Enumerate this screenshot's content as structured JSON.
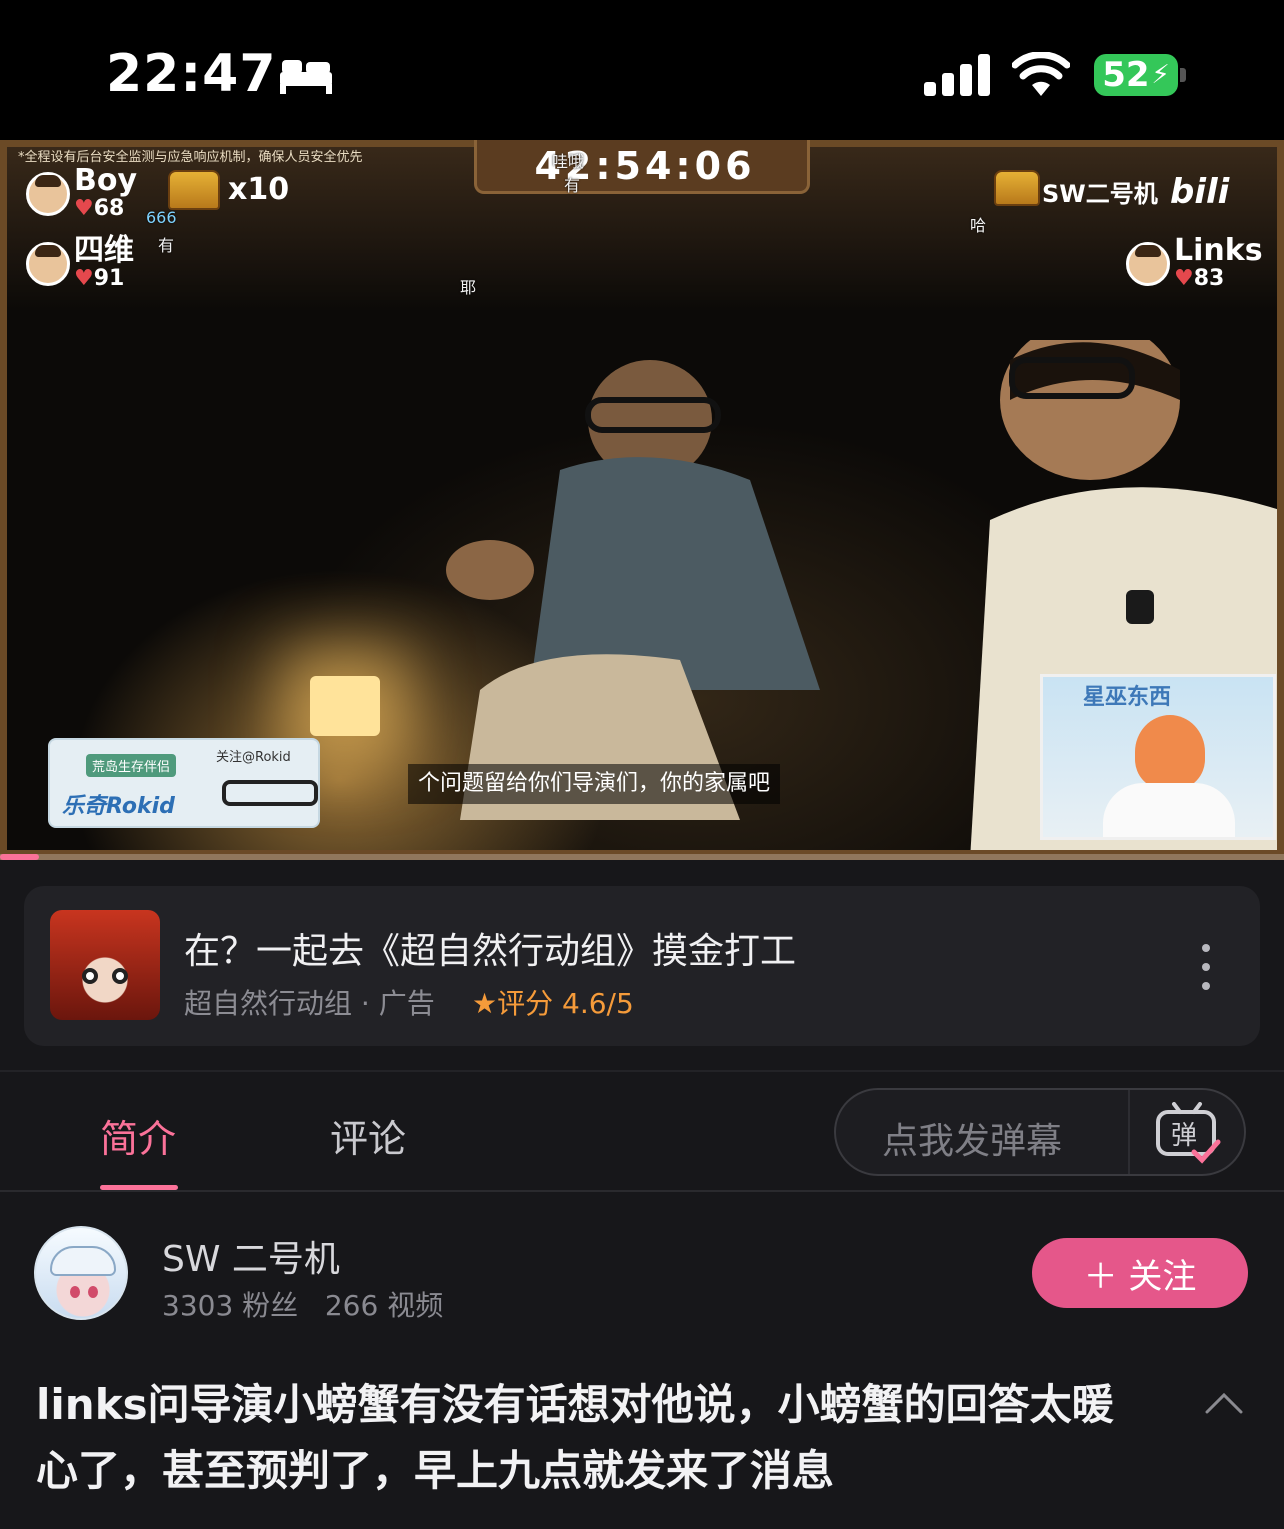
{
  "status_bar": {
    "time": "22:47",
    "battery": "52"
  },
  "video": {
    "safety_notice": "*全程设有后台安全监测与应急响应机制，确保人员安全优先",
    "timer": "42:54:06",
    "players": [
      {
        "name": "Boy",
        "hearts": "68"
      },
      {
        "name": "四维",
        "hearts": "91"
      },
      {
        "name": "Links",
        "hearts": "83"
      }
    ],
    "chest_count": "x10",
    "top_right_tag": "SW二号机",
    "platform_logo": "bilibili",
    "floating_danmaku": [
      "666",
      "有",
      "耶",
      "哇哦",
      "有",
      "哈"
    ],
    "subtitle": "个问题留给你们导演们，你的家属吧",
    "sponsor": {
      "tag": "荒岛生存伴侣",
      "follow": "关注@Rokid",
      "brand": "乐奇Rokid"
    },
    "pip_title": "星巫东西",
    "progress": 0.03
  },
  "ad": {
    "title": "在？一起去《超自然行动组》摸金打工",
    "meta": "超自然行动组 · 广告",
    "rating": "评分 4.6/5"
  },
  "tabs": [
    {
      "label": "简介",
      "active": true
    },
    {
      "label": "评论",
      "active": false
    }
  ],
  "danmaku_input": {
    "placeholder": "点我发弹幕",
    "icon_label": "弹"
  },
  "uploader": {
    "name": "SW 二号机",
    "stats": "3303 粉丝   266 视频",
    "follow_label": "＋ 关注"
  },
  "video_title": "links问导演小螃蟹有没有话想对他说，小螃蟹的回答太暖心了，甚至预判了，早上九点就发来了消息",
  "colors": {
    "accent": "#fb7299",
    "follow": "#e5578a",
    "rating": "#f59b3a",
    "battery": "#34c759"
  }
}
